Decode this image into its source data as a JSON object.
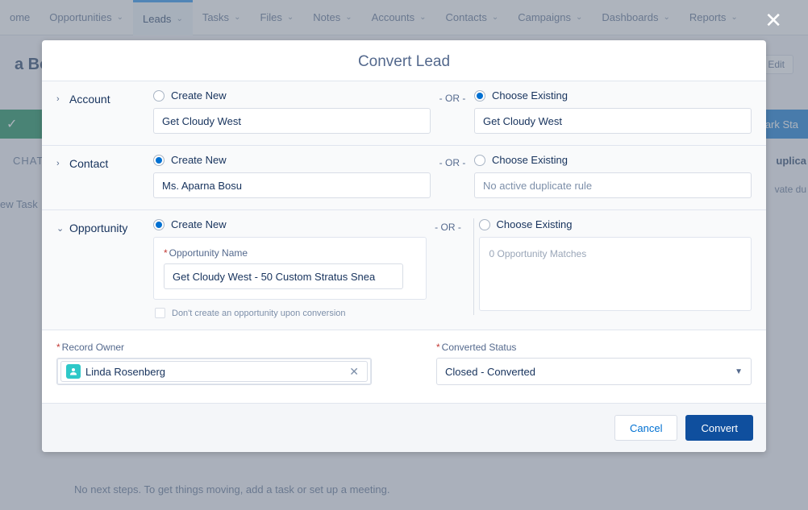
{
  "nav": {
    "items": [
      {
        "label": "ome",
        "chev": false
      },
      {
        "label": "Opportunities",
        "chev": true
      },
      {
        "label": "Leads",
        "chev": true,
        "active": true
      },
      {
        "label": "Tasks",
        "chev": true
      },
      {
        "label": "Files",
        "chev": true
      },
      {
        "label": "Notes",
        "chev": true
      },
      {
        "label": "Accounts",
        "chev": true
      },
      {
        "label": "Contacts",
        "chev": true
      },
      {
        "label": "Campaigns",
        "chev": true
      },
      {
        "label": "Dashboards",
        "chev": true
      },
      {
        "label": "Reports",
        "chev": true
      }
    ]
  },
  "bg": {
    "record_name": "a Bos",
    "edit": "Edit",
    "mark_status": "ark Sta",
    "chat": "CHAT",
    "new_task": "ew Task",
    "dup": "uplica",
    "dup2": "vate du",
    "no_steps": "No next steps. To get things moving, add a task or set up a meeting."
  },
  "modal": {
    "title": "Convert Lead",
    "or": "- OR -",
    "account": {
      "section": "Account",
      "create_new": "Create New",
      "create_value": "Get Cloudy West",
      "choose_existing": "Choose Existing",
      "existing_value": "Get Cloudy West",
      "selected": "existing"
    },
    "contact": {
      "section": "Contact",
      "create_new": "Create New",
      "create_value": "Ms. Aparna Bosu",
      "choose_existing": "Choose Existing",
      "existing_placeholder": "No active duplicate rule",
      "selected": "new"
    },
    "opportunity": {
      "section": "Opportunity",
      "create_new": "Create New",
      "choose_existing": "Choose Existing",
      "name_label": "Opportunity Name",
      "name_value": "Get Cloudy West - 50 Custom Stratus Snea",
      "dont_create": "Don't create an opportunity upon conversion",
      "matches": "0 Opportunity Matches",
      "selected": "new"
    },
    "owner": {
      "label": "Record Owner",
      "value": "Linda Rosenberg"
    },
    "status": {
      "label": "Converted Status",
      "value": "Closed - Converted"
    },
    "footer": {
      "cancel": "Cancel",
      "convert": "Convert"
    }
  }
}
